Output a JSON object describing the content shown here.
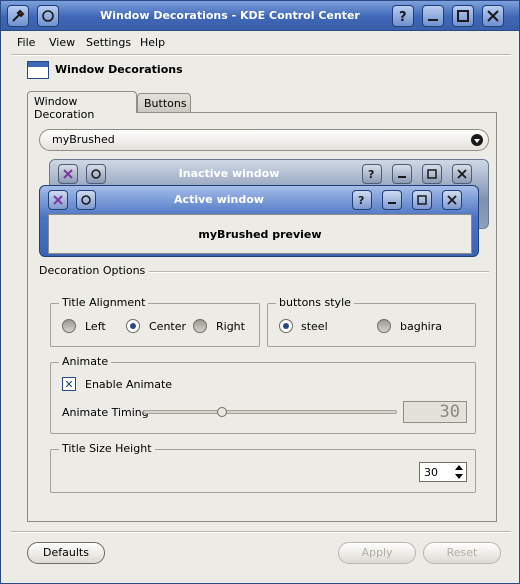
{
  "window": {
    "title": "Window Decorations - KDE Control Center"
  },
  "menu": {
    "file": "File",
    "view": "View",
    "settings": "Settings",
    "help": "Help"
  },
  "header": {
    "title": "Window Decorations"
  },
  "tabs": {
    "decoration": "Window Decoration",
    "buttons": "Buttons"
  },
  "decoration": {
    "selected": "myBrushed"
  },
  "preview": {
    "inactive_title": "Inactive window",
    "active_title": "Active window",
    "body_text": "myBrushed preview"
  },
  "options": {
    "section_label": "Decoration Options",
    "title_alignment": {
      "label": "Title Alignment",
      "left": "Left",
      "center": "Center",
      "right": "Right",
      "selected": "center"
    },
    "buttons_style": {
      "label": "buttons style",
      "steel": "steel",
      "baghira": "baghira",
      "selected": "steel"
    },
    "animate": {
      "label": "Animate",
      "enable_label": "Enable Animate",
      "enabled": true,
      "timing_label": "Animate Timing",
      "timing_value": "30",
      "timing_fraction": 0.3
    },
    "title_size": {
      "label": "Title Size Height",
      "value": "30"
    }
  },
  "buttons": {
    "defaults": "Defaults",
    "apply": "Apply",
    "reset": "Reset"
  },
  "colors": {
    "titlebar": "#3f67b7",
    "background": "#ecebe6",
    "accent": "#2a4a86"
  }
}
